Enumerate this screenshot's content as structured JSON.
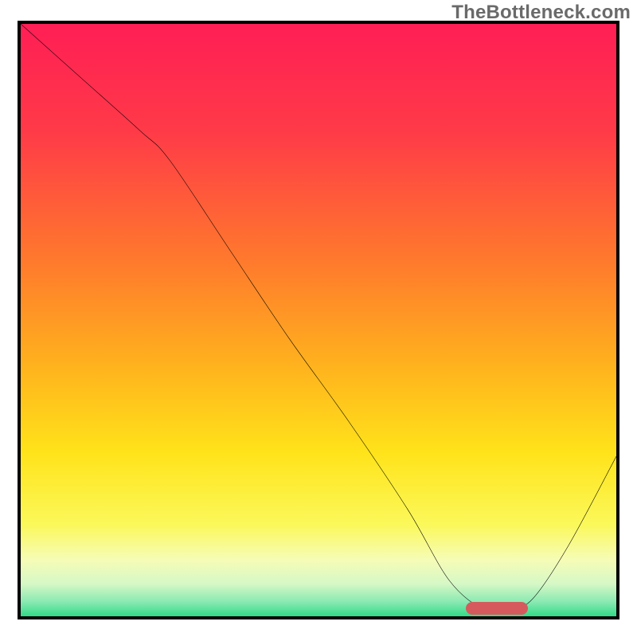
{
  "watermark": "TheBottleneck.com",
  "chart_data": {
    "type": "line",
    "title": "",
    "xlabel": "",
    "ylabel": "",
    "xlim": [
      0,
      100
    ],
    "ylim": [
      0,
      100
    ],
    "gradient_stops": [
      {
        "pct": 0,
        "color": "#ff1e55"
      },
      {
        "pct": 18,
        "color": "#ff3a48"
      },
      {
        "pct": 40,
        "color": "#ff7a2c"
      },
      {
        "pct": 58,
        "color": "#ffb41d"
      },
      {
        "pct": 72,
        "color": "#ffe31a"
      },
      {
        "pct": 84,
        "color": "#fbf85a"
      },
      {
        "pct": 90,
        "color": "#f6fcb6"
      },
      {
        "pct": 94,
        "color": "#d6f8c6"
      },
      {
        "pct": 97,
        "color": "#8be9b2"
      },
      {
        "pct": 100,
        "color": "#1ed97e"
      }
    ],
    "series": [
      {
        "name": "bottleneck-curve",
        "x": [
          0,
          10,
          20,
          25,
          35,
          45,
          55,
          65,
          72,
          78,
          82,
          86,
          92,
          100
        ],
        "y": [
          100,
          91,
          82,
          77,
          62,
          47,
          33,
          18,
          6,
          1,
          1,
          3,
          12,
          27
        ]
      }
    ],
    "marker": {
      "name": "optimal-range",
      "x_center": 80,
      "y_center": 1.3,
      "color": "#d65a5d"
    },
    "grid": false,
    "legend": false
  }
}
